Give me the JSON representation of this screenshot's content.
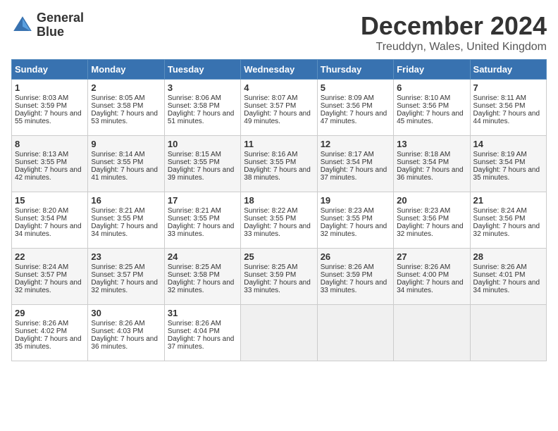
{
  "header": {
    "logo_line1": "General",
    "logo_line2": "Blue",
    "month": "December 2024",
    "location": "Treuddyn, Wales, United Kingdom"
  },
  "days_of_week": [
    "Sunday",
    "Monday",
    "Tuesday",
    "Wednesday",
    "Thursday",
    "Friday",
    "Saturday"
  ],
  "weeks": [
    [
      {
        "day": "1",
        "sunrise": "Sunrise: 8:03 AM",
        "sunset": "Sunset: 3:59 PM",
        "daylight": "Daylight: 7 hours and 55 minutes."
      },
      {
        "day": "2",
        "sunrise": "Sunrise: 8:05 AM",
        "sunset": "Sunset: 3:58 PM",
        "daylight": "Daylight: 7 hours and 53 minutes."
      },
      {
        "day": "3",
        "sunrise": "Sunrise: 8:06 AM",
        "sunset": "Sunset: 3:58 PM",
        "daylight": "Daylight: 7 hours and 51 minutes."
      },
      {
        "day": "4",
        "sunrise": "Sunrise: 8:07 AM",
        "sunset": "Sunset: 3:57 PM",
        "daylight": "Daylight: 7 hours and 49 minutes."
      },
      {
        "day": "5",
        "sunrise": "Sunrise: 8:09 AM",
        "sunset": "Sunset: 3:56 PM",
        "daylight": "Daylight: 7 hours and 47 minutes."
      },
      {
        "day": "6",
        "sunrise": "Sunrise: 8:10 AM",
        "sunset": "Sunset: 3:56 PM",
        "daylight": "Daylight: 7 hours and 45 minutes."
      },
      {
        "day": "7",
        "sunrise": "Sunrise: 8:11 AM",
        "sunset": "Sunset: 3:56 PM",
        "daylight": "Daylight: 7 hours and 44 minutes."
      }
    ],
    [
      {
        "day": "8",
        "sunrise": "Sunrise: 8:13 AM",
        "sunset": "Sunset: 3:55 PM",
        "daylight": "Daylight: 7 hours and 42 minutes."
      },
      {
        "day": "9",
        "sunrise": "Sunrise: 8:14 AM",
        "sunset": "Sunset: 3:55 PM",
        "daylight": "Daylight: 7 hours and 41 minutes."
      },
      {
        "day": "10",
        "sunrise": "Sunrise: 8:15 AM",
        "sunset": "Sunset: 3:55 PM",
        "daylight": "Daylight: 7 hours and 39 minutes."
      },
      {
        "day": "11",
        "sunrise": "Sunrise: 8:16 AM",
        "sunset": "Sunset: 3:55 PM",
        "daylight": "Daylight: 7 hours and 38 minutes."
      },
      {
        "day": "12",
        "sunrise": "Sunrise: 8:17 AM",
        "sunset": "Sunset: 3:54 PM",
        "daylight": "Daylight: 7 hours and 37 minutes."
      },
      {
        "day": "13",
        "sunrise": "Sunrise: 8:18 AM",
        "sunset": "Sunset: 3:54 PM",
        "daylight": "Daylight: 7 hours and 36 minutes."
      },
      {
        "day": "14",
        "sunrise": "Sunrise: 8:19 AM",
        "sunset": "Sunset: 3:54 PM",
        "daylight": "Daylight: 7 hours and 35 minutes."
      }
    ],
    [
      {
        "day": "15",
        "sunrise": "Sunrise: 8:20 AM",
        "sunset": "Sunset: 3:54 PM",
        "daylight": "Daylight: 7 hours and 34 minutes."
      },
      {
        "day": "16",
        "sunrise": "Sunrise: 8:21 AM",
        "sunset": "Sunset: 3:55 PM",
        "daylight": "Daylight: 7 hours and 34 minutes."
      },
      {
        "day": "17",
        "sunrise": "Sunrise: 8:21 AM",
        "sunset": "Sunset: 3:55 PM",
        "daylight": "Daylight: 7 hours and 33 minutes."
      },
      {
        "day": "18",
        "sunrise": "Sunrise: 8:22 AM",
        "sunset": "Sunset: 3:55 PM",
        "daylight": "Daylight: 7 hours and 33 minutes."
      },
      {
        "day": "19",
        "sunrise": "Sunrise: 8:23 AM",
        "sunset": "Sunset: 3:55 PM",
        "daylight": "Daylight: 7 hours and 32 minutes."
      },
      {
        "day": "20",
        "sunrise": "Sunrise: 8:23 AM",
        "sunset": "Sunset: 3:56 PM",
        "daylight": "Daylight: 7 hours and 32 minutes."
      },
      {
        "day": "21",
        "sunrise": "Sunrise: 8:24 AM",
        "sunset": "Sunset: 3:56 PM",
        "daylight": "Daylight: 7 hours and 32 minutes."
      }
    ],
    [
      {
        "day": "22",
        "sunrise": "Sunrise: 8:24 AM",
        "sunset": "Sunset: 3:57 PM",
        "daylight": "Daylight: 7 hours and 32 minutes."
      },
      {
        "day": "23",
        "sunrise": "Sunrise: 8:25 AM",
        "sunset": "Sunset: 3:57 PM",
        "daylight": "Daylight: 7 hours and 32 minutes."
      },
      {
        "day": "24",
        "sunrise": "Sunrise: 8:25 AM",
        "sunset": "Sunset: 3:58 PM",
        "daylight": "Daylight: 7 hours and 32 minutes."
      },
      {
        "day": "25",
        "sunrise": "Sunrise: 8:25 AM",
        "sunset": "Sunset: 3:59 PM",
        "daylight": "Daylight: 7 hours and 33 minutes."
      },
      {
        "day": "26",
        "sunrise": "Sunrise: 8:26 AM",
        "sunset": "Sunset: 3:59 PM",
        "daylight": "Daylight: 7 hours and 33 minutes."
      },
      {
        "day": "27",
        "sunrise": "Sunrise: 8:26 AM",
        "sunset": "Sunset: 4:00 PM",
        "daylight": "Daylight: 7 hours and 34 minutes."
      },
      {
        "day": "28",
        "sunrise": "Sunrise: 8:26 AM",
        "sunset": "Sunset: 4:01 PM",
        "daylight": "Daylight: 7 hours and 34 minutes."
      }
    ],
    [
      {
        "day": "29",
        "sunrise": "Sunrise: 8:26 AM",
        "sunset": "Sunset: 4:02 PM",
        "daylight": "Daylight: 7 hours and 35 minutes."
      },
      {
        "day": "30",
        "sunrise": "Sunrise: 8:26 AM",
        "sunset": "Sunset: 4:03 PM",
        "daylight": "Daylight: 7 hours and 36 minutes."
      },
      {
        "day": "31",
        "sunrise": "Sunrise: 8:26 AM",
        "sunset": "Sunset: 4:04 PM",
        "daylight": "Daylight: 7 hours and 37 minutes."
      },
      null,
      null,
      null,
      null
    ]
  ]
}
